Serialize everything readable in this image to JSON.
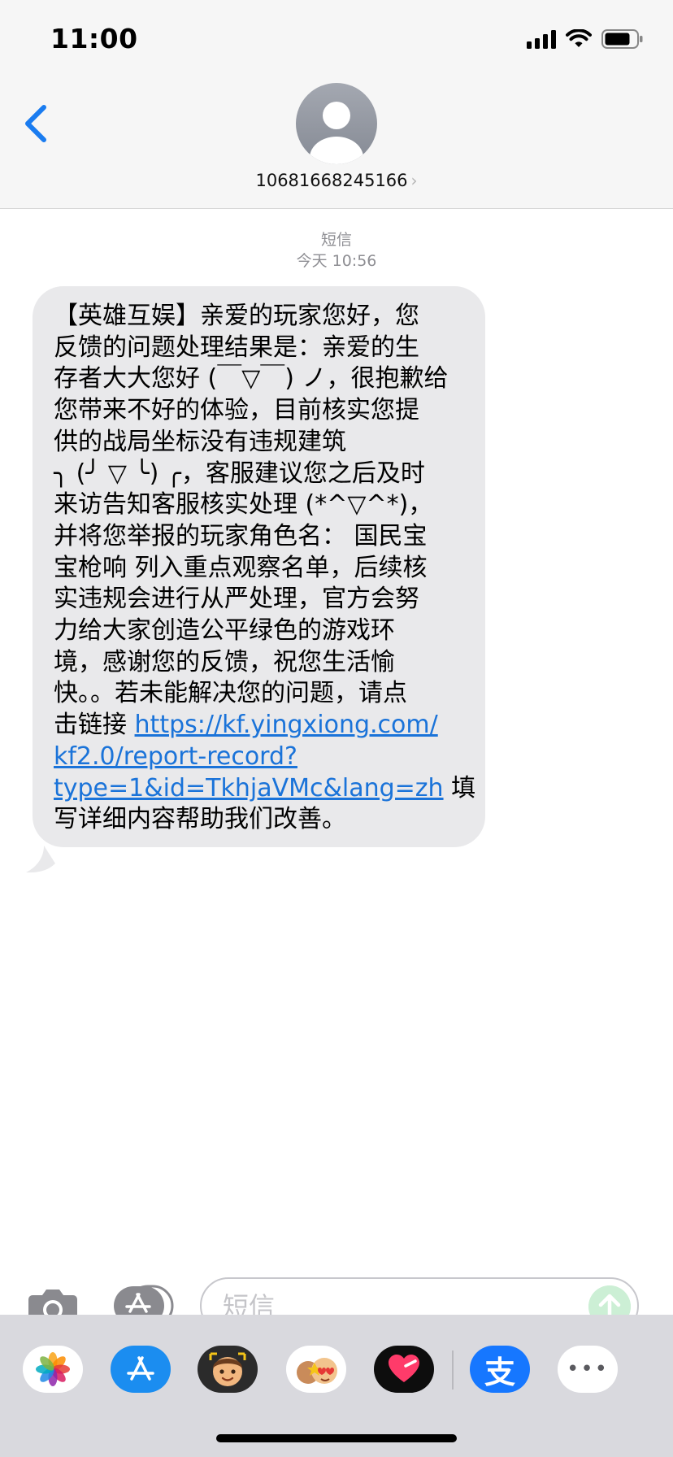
{
  "status_bar": {
    "time": "11:00"
  },
  "header": {
    "contact_number": "10681668245166",
    "chevron": "›"
  },
  "thread": {
    "service_label": "短信",
    "timestamp": "今天 10:56",
    "message": {
      "lines": [
        "【英雄互娱】亲爱的玩家您好，您",
        "反馈的问题处理结果是：亲爱的生",
        "存者大大您好 (￣▽￣) ノ，很抱歉给",
        "您带来不好的体验，目前核实您提",
        "供的战局坐标没有违规建筑",
        "╮ (╯ ▽ ╰) ╭，客服建议您之后及时",
        "来访告知客服核实处理 (*^▽^*)，",
        "并将您举报的玩家角色名： 国民宝",
        "宝枪响 列入重点观察名单，后续核",
        "实违规会进行从严处理，官方会努",
        "力给大家创造公平绿色的游戏环",
        "境，感谢您的反馈，祝您生活愉",
        "快。。若未能解决您的问题，请点"
      ],
      "link_prefix": "击链接 ",
      "link_part1": "https://kf.yingxiong.com/",
      "link_part2": "kf2.0/report-record?",
      "link_part3": "type=1&id=TkhjaVMc&lang=zh",
      "after_link": " 填",
      "last_line": "写详细内容帮助我们改善。"
    }
  },
  "input": {
    "placeholder": "短信"
  },
  "tray": {
    "apps": [
      "photos-app",
      "app-store-app",
      "memoji-stickers-app",
      "animoji-app",
      "digital-touch-app",
      "alipay-app",
      "more-apps"
    ],
    "alipay_glyph": "支",
    "more_glyph": "•••"
  },
  "colors": {
    "accent_blue": "#1a7cf0",
    "bubble_gray": "#e9e9eb",
    "link_blue": "#1a73d9"
  }
}
